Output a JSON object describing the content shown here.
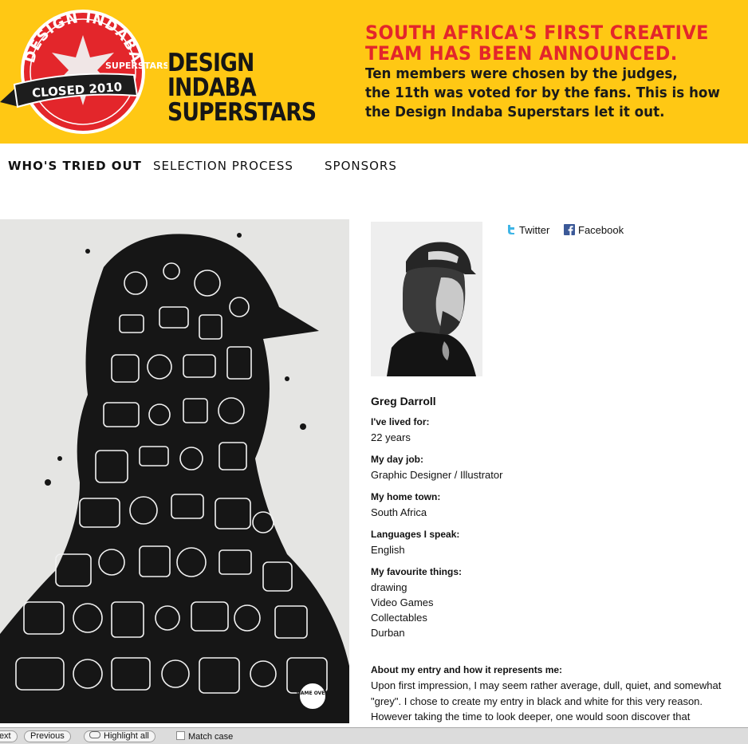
{
  "banner": {
    "seal_top": "DESIGN INDABA",
    "seal_ribbon": "CLOSED 2010",
    "seal_small": "SUPERSTARS",
    "brand_line1": "DESIGN INDABA",
    "brand_line2": "SUPERSTARS",
    "headline_red_1": "SOUTH AFRICA'S FIRST CREATIVE",
    "headline_red_2": "TEAM HAS BEEN ANNOUNCED.",
    "headline_black_1": "Ten members were chosen by the judges,",
    "headline_black_2": "the 11th was voted for by the fans. This is how",
    "headline_black_3": "the Design Indaba Superstars let it out.",
    "colors": {
      "background": "#ffc814",
      "red": "#e3262b"
    }
  },
  "nav": {
    "items": [
      {
        "label": "WHO'S TRIED OUT",
        "active": true
      },
      {
        "label": "SELECTION PROCESS",
        "active": false
      },
      {
        "label": "SPONSORS",
        "active": false
      }
    ]
  },
  "artwork": {
    "signature": "GAME OVER"
  },
  "social": {
    "twitter": {
      "label": "Twitter",
      "icon": "twitter-icon"
    },
    "facebook": {
      "label": "Facebook",
      "icon": "facebook-icon"
    }
  },
  "profile": {
    "name": "Greg Darroll",
    "fields": [
      {
        "label": "I've lived for:",
        "values": [
          "22 years"
        ]
      },
      {
        "label": "My day job:",
        "values": [
          "Graphic Designer / Illustrator"
        ]
      },
      {
        "label": "My home town:",
        "values": [
          "South Africa"
        ]
      },
      {
        "label": "Languages I speak:",
        "values": [
          "English"
        ]
      },
      {
        "label": "My favourite things:",
        "values": [
          "drawing",
          "Video Games",
          "Collectables",
          "Durban"
        ]
      }
    ],
    "about_label": "About my entry and how it represents me:",
    "about_lines": [
      "Upon first impression, I may seem rather average, dull, quiet, and somewhat",
      "\"grey\". I chose to create my entry in black and white for this very reason.",
      "However taking the time to look deeper, one would soon discover that"
    ]
  },
  "findbar": {
    "next": "Next",
    "previous": "Previous",
    "highlight_all": "Highlight all",
    "match_case": "Match case"
  }
}
